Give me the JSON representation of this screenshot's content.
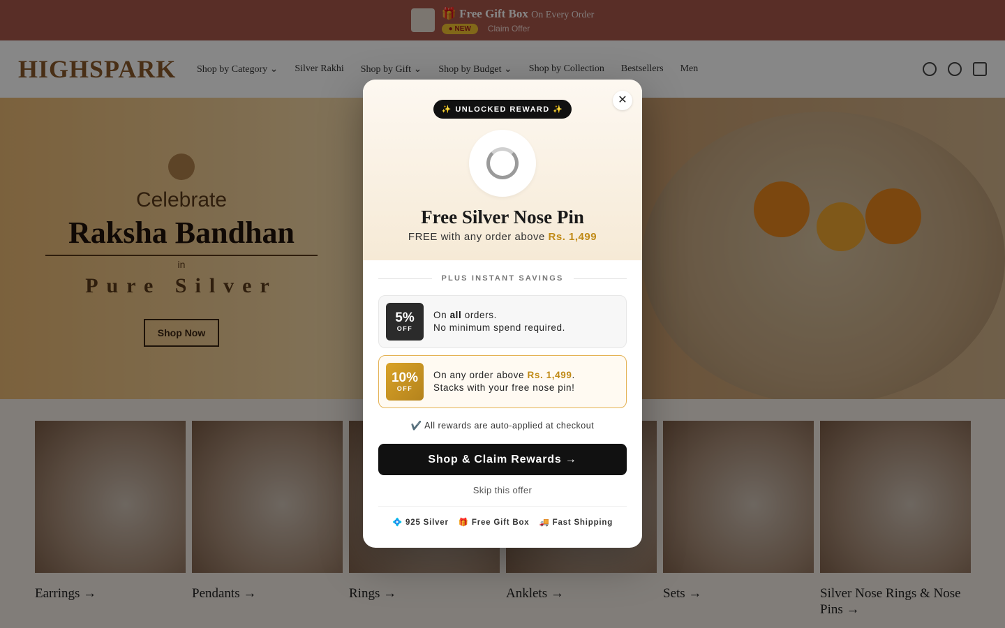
{
  "announcement": {
    "title": "🎁 Free Gift Box",
    "subtitle": "On Every Order",
    "badge": "● NEW",
    "claim": "Claim Offer"
  },
  "header": {
    "logo": "HIGHSPARK",
    "nav": [
      "Shop by Category ⌄",
      "Silver Rakhi",
      "Shop by Gift ⌄",
      "Shop by Budget ⌄",
      "Shop by Collection",
      "Bestsellers",
      "Men"
    ],
    "icons": [
      "search-icon",
      "account-icon",
      "cart-icon"
    ]
  },
  "hero": {
    "celebrate": "Celebrate",
    "title": "Raksha Bandhan",
    "in": "in",
    "subtitle": "Pure Silver",
    "button": "Shop Now"
  },
  "categories": [
    "Earrings →",
    "Pendants →",
    "Rings →",
    "Anklets →",
    "Sets →",
    "Silver Nose Rings & Nose Pins →"
  ],
  "modal": {
    "close": "✕",
    "pill": "✨ UNLOCKED REWARD ✨",
    "reward_title": "Free Silver Nose Pin",
    "reward_sub_prefix": "FREE with any order above ",
    "reward_sub_amount": "Rs. 1,499",
    "savings_label": "PLUS INSTANT SAVINGS",
    "offers": [
      {
        "pct": "5%",
        "off": "OFF",
        "line1_prefix": "On ",
        "line1_bold": "all",
        "line1_suffix": " orders.",
        "line2": "No minimum spend required."
      },
      {
        "pct": "10%",
        "off": "OFF",
        "line1_prefix": "On any order above ",
        "line1_bold": "Rs. 1,499",
        "line1_suffix": ".",
        "line2": "Stacks with your free nose pin!"
      }
    ],
    "auto_note": "✔️ All rewards are auto-applied at checkout",
    "cta": "Shop & Claim Rewards  →",
    "skip": "Skip this offer",
    "trust": [
      "💠 925 Silver",
      "🎁 Free Gift Box",
      "🚚 Fast Shipping"
    ]
  },
  "colors": {
    "accent_gold": "#c08a16",
    "cta_black": "#111111",
    "announcement_bg": "#a9574a"
  }
}
